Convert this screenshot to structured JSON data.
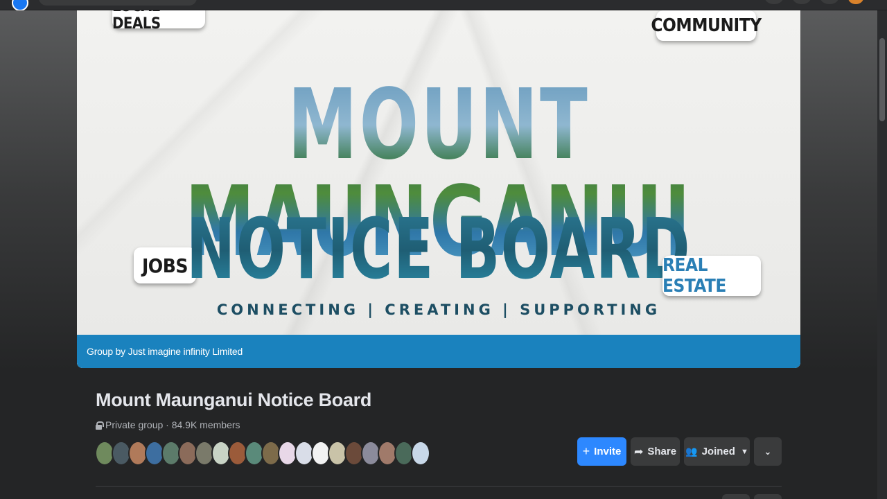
{
  "cover": {
    "tags": {
      "local_deals": "LOCAL DEALS",
      "community": "COMMUNITY",
      "jobs": "JOBS",
      "real_estate": "REAL ESTATE"
    },
    "title_top": "MOUNT MAUNGANUI",
    "title_mid": "NOTICE BOARD",
    "tagline": "CONNECTING | CREATING | SUPPORTING",
    "footer": "Group by Just imagine infinity Limited"
  },
  "group": {
    "name": "Mount Maunganui Notice Board",
    "meta": "Private group · 84.9K members",
    "member_avatar_colors": [
      "#6f8a5d",
      "#4a5a63",
      "#b07a5a",
      "#3d6ea0",
      "#5c7b6a",
      "#8b6b5a",
      "#7a7a6a",
      "#c8d3c5",
      "#9b5b3a",
      "#5a8a7a",
      "#7d6b4a",
      "#e8d8e8",
      "#d9dde8",
      "#f2f2f2",
      "#c9c3a8",
      "#6b4a3a",
      "#8b8b9b",
      "#a07a6a",
      "#4a6a5a",
      "#c8d8e8"
    ]
  },
  "actions": {
    "invite": "Invite",
    "share": "Share",
    "joined": "Joined"
  },
  "colors": {
    "accent": "#2d88ff",
    "cover_footer": "#1a82be"
  }
}
